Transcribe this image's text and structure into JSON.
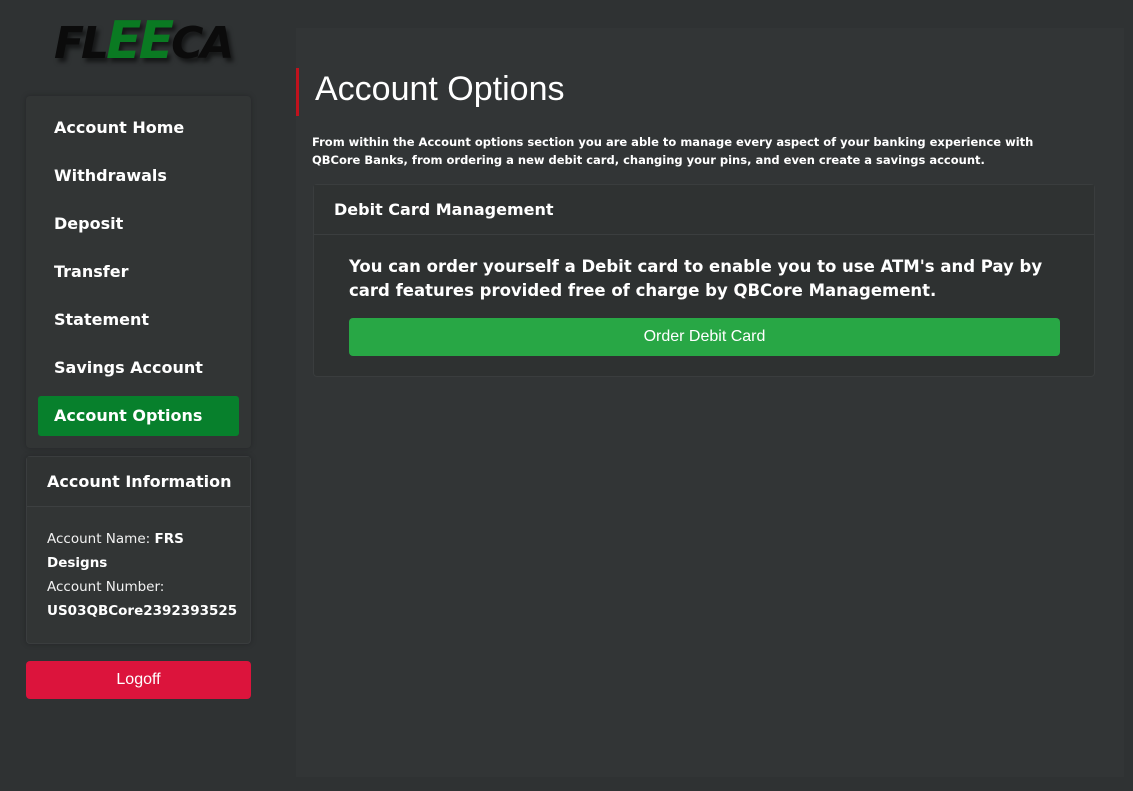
{
  "logo": {
    "part1": "FL",
    "part2": "EE",
    "part3": "CA"
  },
  "sidebar": {
    "items": [
      {
        "label": "Account Home"
      },
      {
        "label": "Withdrawals"
      },
      {
        "label": "Deposit"
      },
      {
        "label": "Transfer"
      },
      {
        "label": "Statement"
      },
      {
        "label": "Savings Account"
      },
      {
        "label": "Account Options"
      }
    ],
    "active_item": "Account Options"
  },
  "account_info": {
    "title": "Account Information",
    "name_label": "Account Name:",
    "name_value": "FRS Designs",
    "number_label": "Account Number:",
    "number_value": "US03QBCore2392393525"
  },
  "logoff_label": "Logoff",
  "main": {
    "title": "Account Options",
    "intro": "From within the Account options section you are able to manage every aspect of your banking experience with QBCore Banks, from ordering a new debit card, changing your pins, and even create a savings account.",
    "card": {
      "title": "Debit Card Management",
      "text": "You can order yourself a Debit card to enable you to use ATM's and Pay by card features provided free of charge by QBCore Management.",
      "button_label": "Order Debit Card"
    }
  },
  "colors": {
    "background": "#2f3233",
    "active_nav": "#07802c",
    "order_button": "#28a745",
    "logoff_button": "#dc143c",
    "title_accent": "#c0121d",
    "logo_green": "#0a7a22"
  }
}
